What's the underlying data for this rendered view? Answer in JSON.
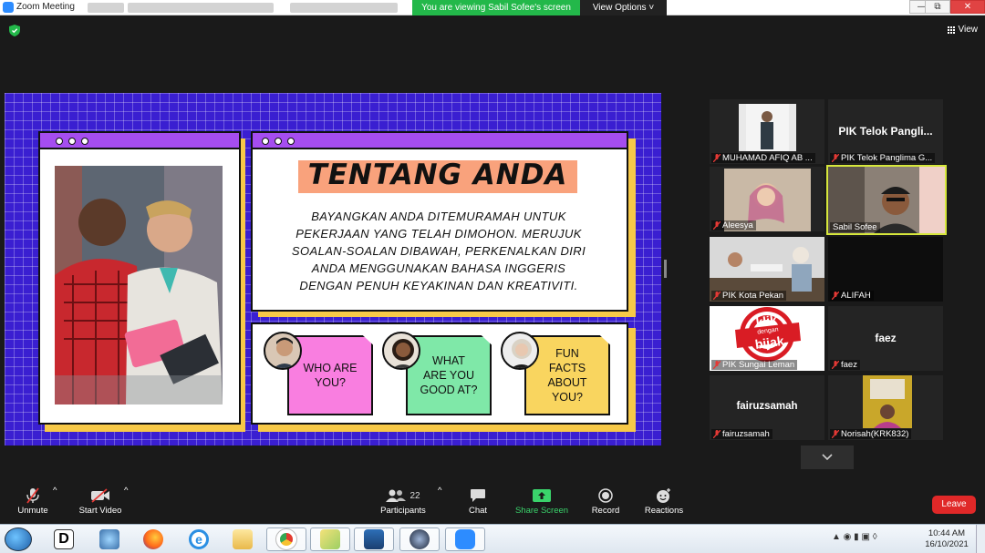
{
  "window": {
    "app_title": "Zoom Meeting",
    "viewing_banner": "You are viewing Sabil Sofee's screen",
    "view_options": "View Options ˅",
    "minimize": "—",
    "restore": "⧉",
    "close": "✕"
  },
  "view_button": "View",
  "slide": {
    "heading": "TENTANG ANDA",
    "body_lines": [
      "BAYANGKAN ANDA DITEMURAMAH UNTUK",
      "PEKERJAAN YANG TELAH DIMOHON. MERUJUK",
      "SOALAN-SOALAN DIBAWAH, PERKENALKAN DIRI",
      "ANDA MENGGUNAKAN BAHASA INGGERIS",
      "DENGAN PENUH KEYAKINAN DAN KREATIVITI."
    ],
    "cards": [
      {
        "lines": [
          "WHO ARE",
          "YOU?"
        ],
        "color": "#f97ee0"
      },
      {
        "lines": [
          "WHAT",
          "ARE YOU",
          "GOOD AT?"
        ],
        "color": "#7fe8a8"
      },
      {
        "lines": [
          "FUN",
          "FACTS",
          "ABOUT",
          "YOU?"
        ],
        "color": "#f9d55f"
      }
    ]
  },
  "participants": [
    {
      "name": "MUHAMAD AFIQ AB ...",
      "video": true,
      "big_text": ""
    },
    {
      "name": "PIK Telok Panglima G...",
      "video": false,
      "big_text": "PIK Telok Pangli..."
    },
    {
      "name": "Aleesya",
      "video": true,
      "big_text": ""
    },
    {
      "name": "Sabil Sofee",
      "video": true,
      "big_text": "",
      "active": true
    },
    {
      "name": "PIK Kota Pekan",
      "video": true,
      "big_text": ""
    },
    {
      "name": "ALIFAH",
      "video": false,
      "big_text": ""
    },
    {
      "name": "PIK Sungai Leman",
      "video": true,
      "big_text": ""
    },
    {
      "name": "faez",
      "video": false,
      "big_text": "faez"
    },
    {
      "name": "fairuzsamah",
      "video": false,
      "big_text": "fairuzsamah"
    },
    {
      "name": "Norisah(KRK832)",
      "video": true,
      "big_text": ""
    }
  ],
  "logo_text": [
    "klik",
    "dengan",
    "bijak"
  ],
  "toolbar": {
    "unmute": "Unmute",
    "start_video": "Start Video",
    "participants": "Participants",
    "participants_count": "22",
    "chat": "Chat",
    "share_screen": "Share Screen",
    "record": "Record",
    "reactions": "Reactions",
    "leave": "Leave",
    "expand": "⌵"
  },
  "taskbar": {
    "time": "10:44 AM",
    "date": "16/10/2021"
  },
  "colors": {
    "slide_bg": "#3a1fd1",
    "share_green": "#3ad36b",
    "leave_red": "#e02828",
    "active_speaker": "#d6e73c"
  }
}
